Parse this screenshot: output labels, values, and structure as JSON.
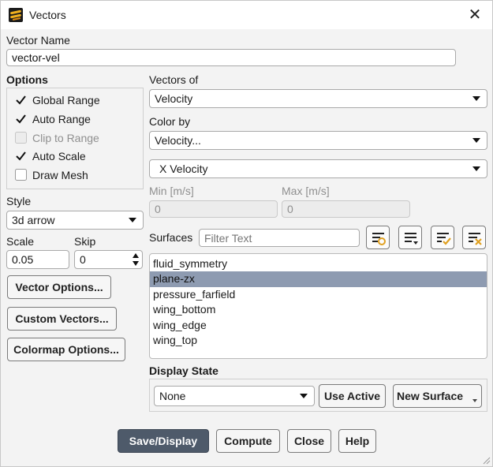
{
  "window": {
    "title": "Vectors",
    "app_icon": "ansys-fluent-icon",
    "close_glyph": "✕"
  },
  "vector_name": {
    "label": "Vector Name",
    "value": "vector-vel"
  },
  "options": {
    "label": "Options",
    "items": [
      {
        "label": "Global Range",
        "checked": true,
        "enabled": true
      },
      {
        "label": "Auto Range",
        "checked": true,
        "enabled": true
      },
      {
        "label": "Clip to Range",
        "checked": false,
        "enabled": false
      },
      {
        "label": "Auto Scale",
        "checked": true,
        "enabled": true
      },
      {
        "label": "Draw Mesh",
        "checked": false,
        "enabled": true
      }
    ]
  },
  "vectors_of": {
    "label": "Vectors of",
    "value": "Velocity"
  },
  "color_by": {
    "label": "Color by",
    "value": "Velocity...",
    "sub_value": "X Velocity"
  },
  "range": {
    "min_label": "Min [m/s]",
    "min_value": "0",
    "max_label": "Max [m/s]",
    "max_value": "0"
  },
  "style": {
    "label": "Style",
    "value": "3d arrow"
  },
  "scale": {
    "label": "Scale",
    "value": "0.05"
  },
  "skip": {
    "label": "Skip",
    "value": "0"
  },
  "side_buttons": {
    "vector_options": "Vector Options...",
    "custom_vectors": "Custom Vectors...",
    "colormap_options": "Colormap Options..."
  },
  "surfaces": {
    "label": "Surfaces",
    "filter_placeholder": "Filter Text",
    "items": [
      "fluid_symmetry",
      "plane-zx",
      "pressure_farfield",
      "wing_bottom",
      "wing_edge",
      "wing_top"
    ],
    "selected_index": 1
  },
  "display_state": {
    "label": "Display State",
    "value": "None",
    "use_active": "Use Active",
    "new_surface": "New Surface"
  },
  "footer": {
    "save_display": "Save/Display",
    "compute": "Compute",
    "close": "Close",
    "help": "Help"
  },
  "colors": {
    "primary_button": "#4e5a6a",
    "selection": "#8e9bb1",
    "accent_yellow": "#f0b01e"
  }
}
